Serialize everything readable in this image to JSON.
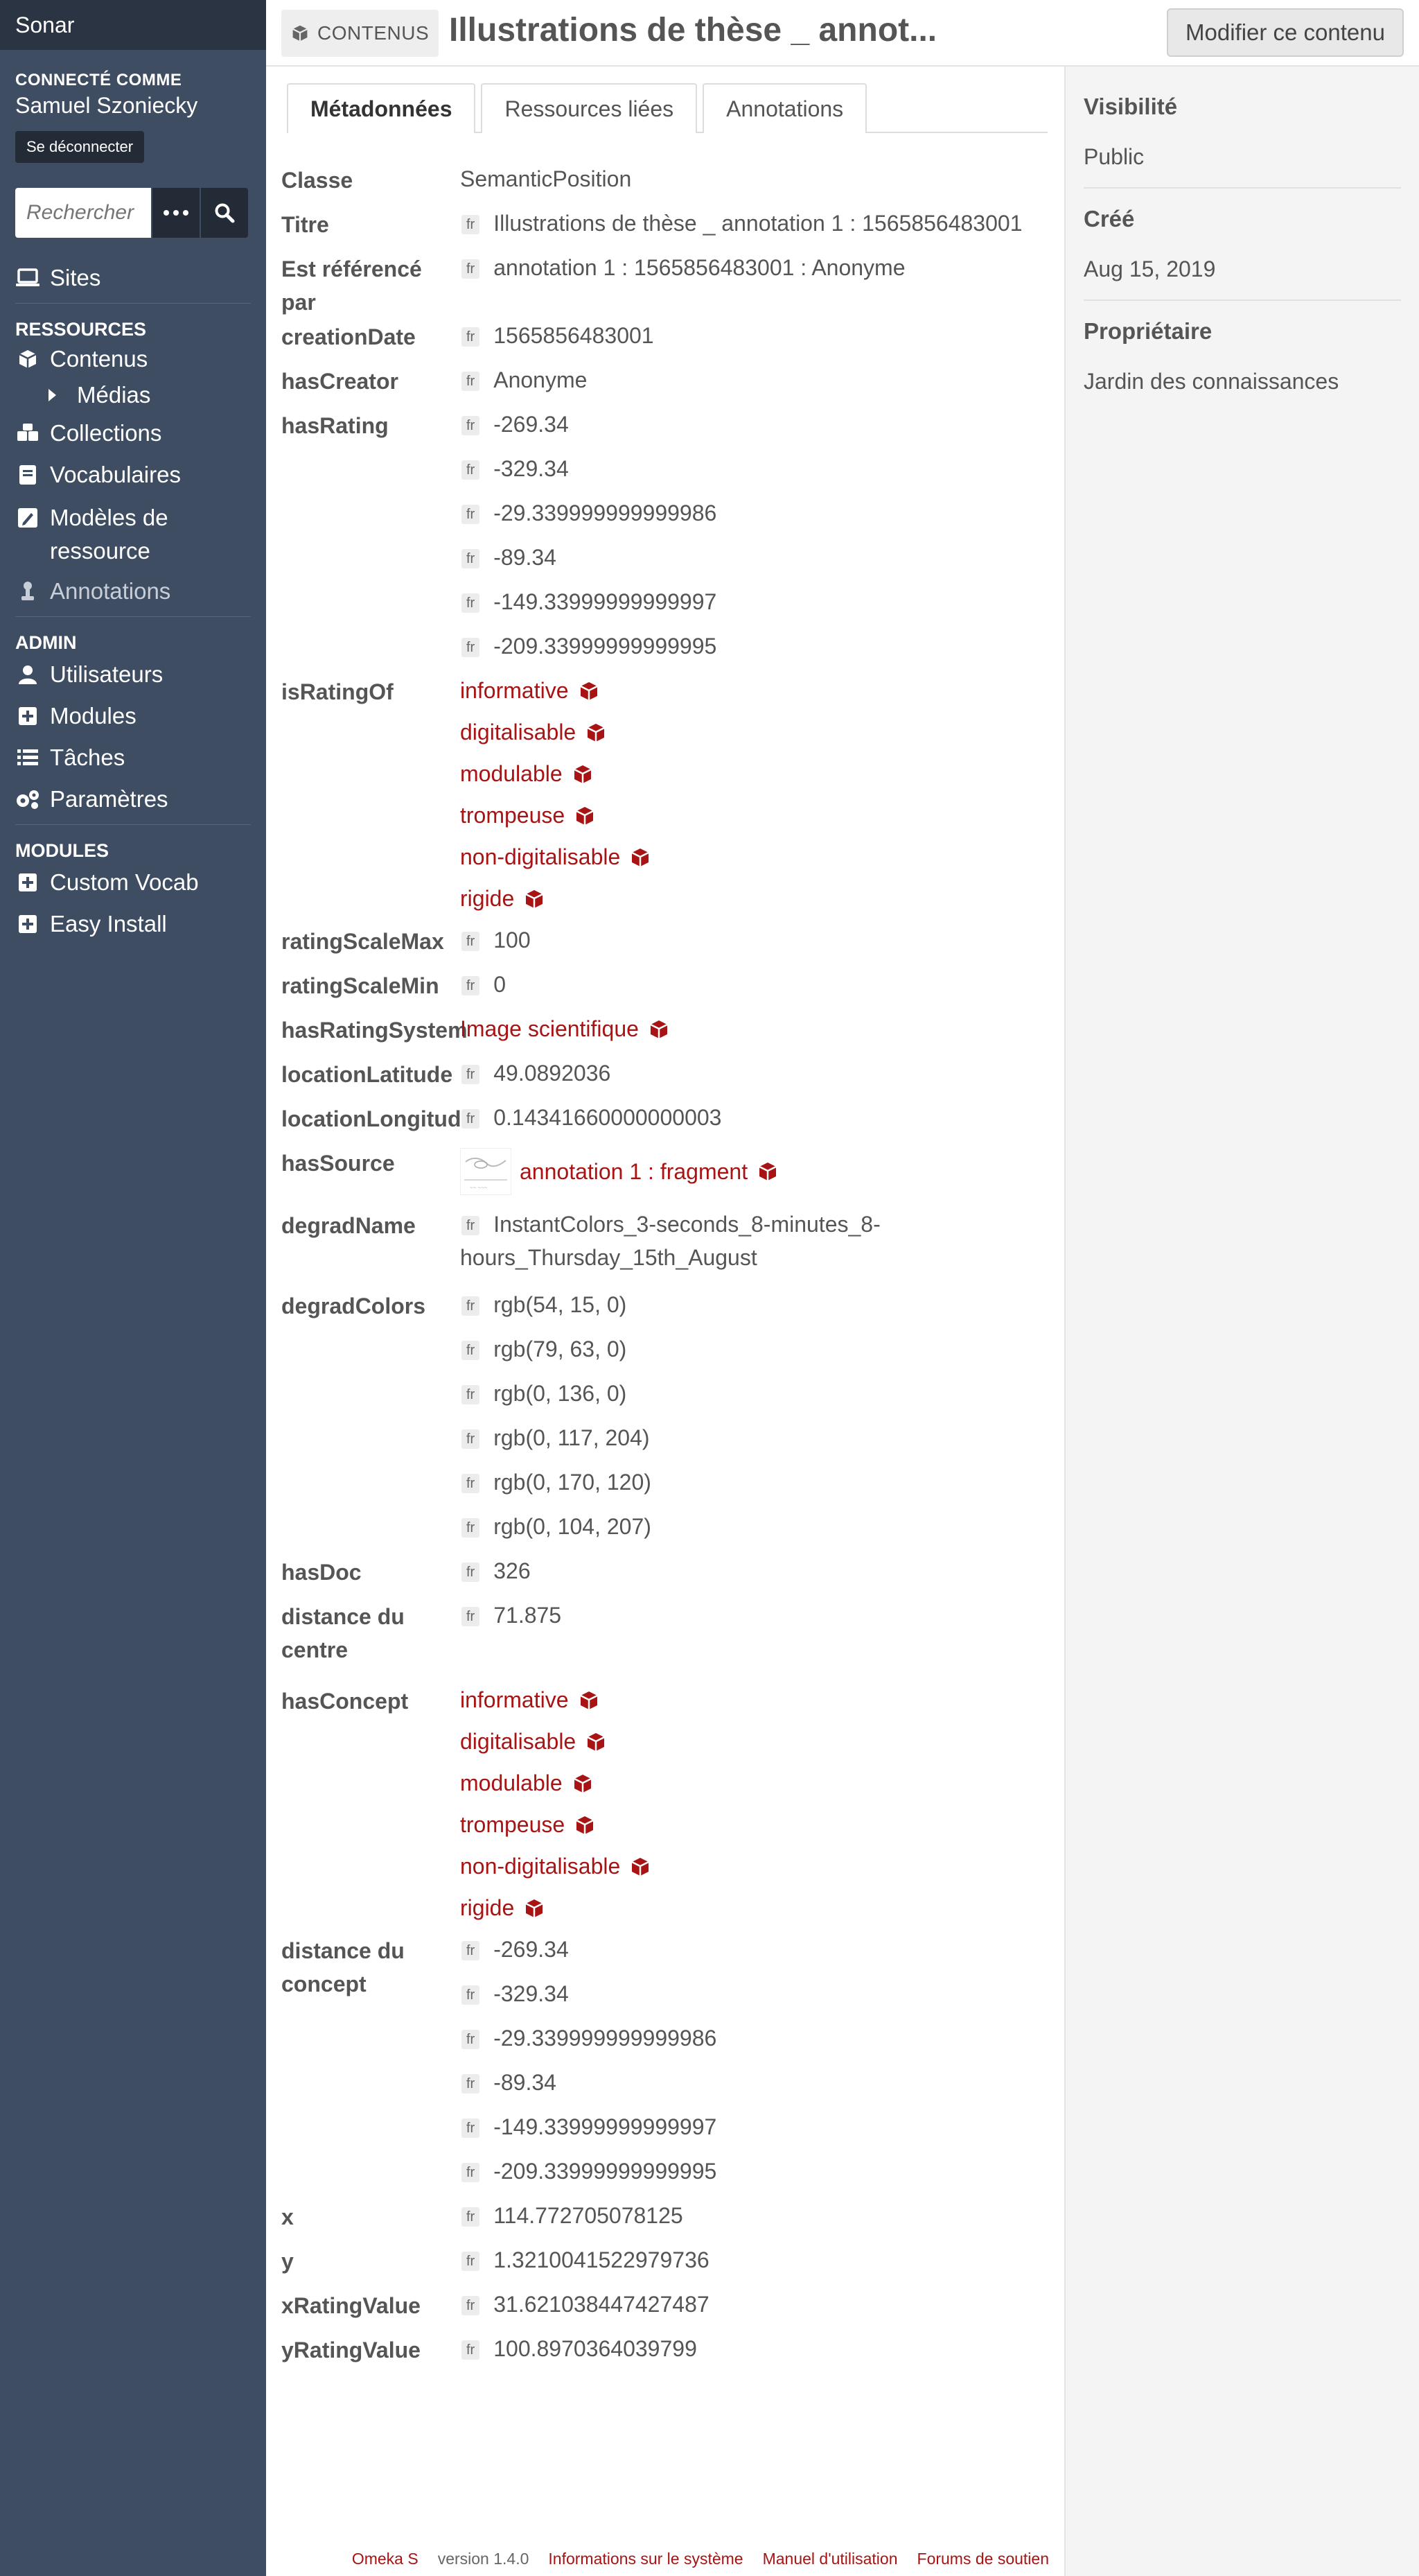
{
  "app": {
    "brand": "Sonar"
  },
  "user": {
    "logged_label": "CONNECTÉ COMME",
    "name": "Samuel Szoniecky",
    "logout": "Se déconnecter"
  },
  "search": {
    "placeholder": "Rechercher d"
  },
  "nav": {
    "sites": "Sites",
    "ressources_title": "RESSOURCES",
    "contenus": "Contenus",
    "medias": "Médias",
    "collections": "Collections",
    "vocabulaires": "Vocabulaires",
    "modeles": "Modèles de ressource",
    "annotations": "Annotations",
    "admin_title": "ADMIN",
    "utilisateurs": "Utilisateurs",
    "modules": "Modules",
    "taches": "Tâches",
    "parametres": "Paramètres",
    "modules_title": "MODULES",
    "custom_vocab": "Custom Vocab",
    "easy_install": "Easy Install"
  },
  "header": {
    "crumb": "CONTENUS",
    "title": "Illustrations de thèse _ annot...",
    "edit": "Modifier ce contenu"
  },
  "tabs": [
    "Métadonnées",
    "Ressources liées",
    "Annotations"
  ],
  "lang_tag": "fr",
  "properties": {
    "classe": {
      "label": "Classe",
      "value": "SemanticPosition"
    },
    "titre": {
      "label": "Titre",
      "value": "Illustrations de thèse _ annotation 1 : 1565856483001"
    },
    "est_reference": {
      "label": "Est référencé par",
      "value": "annotation 1 : 1565856483001 : Anonyme"
    },
    "creation_date": {
      "label": "creationDate",
      "value": "1565856483001"
    },
    "has_creator": {
      "label": "hasCreator",
      "value": "Anonyme"
    },
    "has_rating": {
      "label": "hasRating",
      "values": [
        "-269.34",
        "-329.34",
        "-29.339999999999986",
        "-89.34",
        "-149.33999999999997",
        "-209.33999999999995"
      ]
    },
    "is_rating_of": {
      "label": "isRatingOf",
      "values": [
        "informative",
        "digitalisable",
        "modulable",
        "trompeuse",
        "non-digitalisable",
        "rigide"
      ]
    },
    "rating_scale_max": {
      "label": "ratingScaleMax",
      "value": "100"
    },
    "rating_scale_min": {
      "label": "ratingScaleMin",
      "value": "0"
    },
    "has_rating_system": {
      "label": "hasRatingSystem",
      "value": "Image scientifique"
    },
    "location_latitude": {
      "label": "locationLatitude",
      "value": "49.0892036"
    },
    "location_longitude": {
      "label": "locationLongitude",
      "value": "0.14341660000000003"
    },
    "has_source": {
      "label": "hasSource",
      "value": "annotation 1 : fragment"
    },
    "degrad_name": {
      "label": "degradName",
      "line1": "InstantColors_3-seconds_8-minutes_8-",
      "line2": "hours_Thursday_15th_August"
    },
    "degrad_colors": {
      "label": "degradColors",
      "values": [
        "rgb(54, 15, 0)",
        "rgb(79, 63, 0)",
        "rgb(0, 136, 0)",
        "rgb(0, 117, 204)",
        "rgb(0, 170, 120)",
        "rgb(0, 104, 207)"
      ]
    },
    "has_doc": {
      "label": "hasDoc",
      "value": "326"
    },
    "distance_centre": {
      "label_line1": "distance du",
      "label_line2": "centre",
      "value": "71.875"
    },
    "has_concept": {
      "label": "hasConcept",
      "values": [
        "informative",
        "digitalisable",
        "modulable",
        "trompeuse",
        "non-digitalisable",
        "rigide"
      ]
    },
    "distance_concept": {
      "label_line1": "distance du",
      "label_line2": "concept",
      "values": [
        "-269.34",
        "-329.34",
        "-29.339999999999986",
        "-89.34",
        "-149.33999999999997",
        "-209.33999999999995"
      ]
    },
    "x": {
      "label": "x",
      "value": "114.772705078125"
    },
    "y": {
      "label": "y",
      "value": "1.3210041522979736"
    },
    "x_rating_value": {
      "label": "xRatingValue",
      "value": "31.621038447427487"
    },
    "y_rating_value": {
      "label": "yRatingValue",
      "value": "100.8970364039799"
    }
  },
  "aside": {
    "visibilite_title": "Visibilité",
    "visibilite": "Public",
    "cree_title": "Créé",
    "cree": "Aug 15, 2019",
    "proprietaire_title": "Propriétaire",
    "proprietaire": "Jardin des connaissances"
  },
  "footer": {
    "omeka": "Omeka S",
    "version": "version 1.4.0",
    "info": "Informations sur le système",
    "manual": "Manuel d'utilisation",
    "forums": "Forums de soutien"
  },
  "colors": {
    "sidebar": "#3f4d63",
    "brand_bar": "#2b3442",
    "link": "#a81313"
  }
}
